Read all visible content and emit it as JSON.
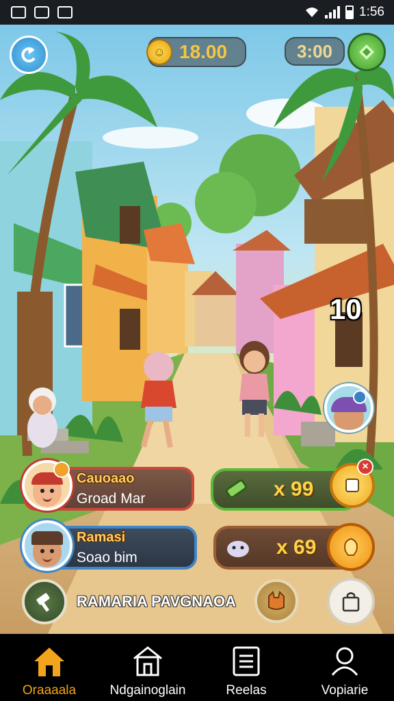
{
  "status_bar": {
    "time": "1:56"
  },
  "hud": {
    "coins": "18.00",
    "timer": "3:00",
    "counter": "10"
  },
  "players": [
    {
      "title": "Cauoaao",
      "subtitle": "Groad Mar"
    },
    {
      "title": "Ramasi",
      "subtitle": "Soao bim"
    }
  ],
  "resources": [
    {
      "value": "x 99"
    },
    {
      "value": "x 69"
    }
  ],
  "action_bar": {
    "label": "RAMARIA PAVGNAOA"
  },
  "nav": {
    "active": 0,
    "items": [
      {
        "label": "Oraaaala",
        "icon": "home-icon"
      },
      {
        "label": "Ndgainoglain",
        "icon": "building-icon"
      },
      {
        "label": "Reelas",
        "icon": "list-icon"
      },
      {
        "label": "Vopiarie",
        "icon": "profile-icon"
      }
    ]
  },
  "colors": {
    "accent": "#f2a51c",
    "card_red_border": "#c7493a",
    "card_blue_border": "#3f86c8",
    "res_green_border": "#5cb83a",
    "res_brown_border": "#9a5d35"
  }
}
